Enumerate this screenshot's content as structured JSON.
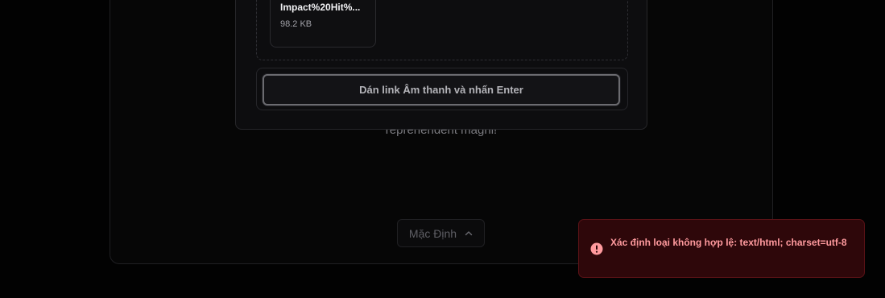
{
  "background_paragraph_end": "reprehenderit magni!",
  "mode_selector": {
    "label": "Mặc Định",
    "icon": "chevron-up-icon"
  },
  "upload": {
    "file": {
      "name": "Impact%20Hit%...",
      "size": "98.2 KB"
    },
    "url_input": {
      "placeholder": "Dán link Âm thanh và nhấn Enter",
      "value": ""
    }
  },
  "toast": {
    "type": "error",
    "icon": "alert-circle-icon",
    "message": "Xác định loại không hợp lệ: text/html; charset=utf-8"
  },
  "colors": {
    "background": "#020202",
    "panel": "#0d0d0f",
    "toast_background": "#2e070a",
    "toast_text": "#ff9a9e",
    "toast_icon": "#ff9a9e"
  }
}
